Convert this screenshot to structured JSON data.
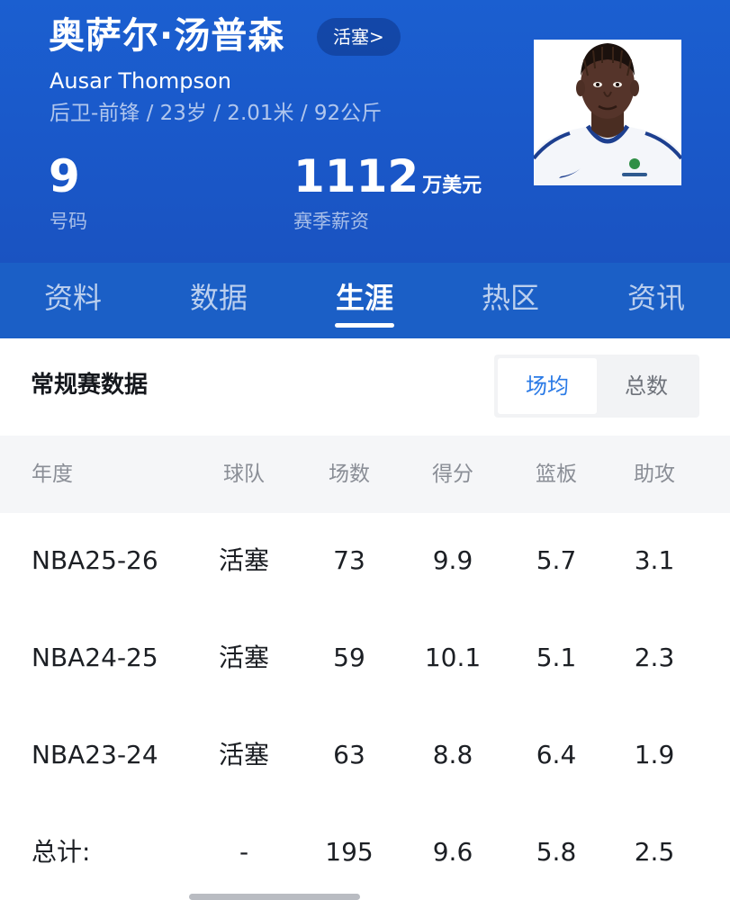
{
  "player": {
    "name_cn": "奥萨尔·汤普森",
    "name_en": "Ausar Thompson",
    "bio": "后卫-前锋 / 23岁 / 2.01米 / 92公斤",
    "team_link": "活塞>",
    "number_value": "9",
    "number_label": "号码",
    "salary_value": "1112",
    "salary_unit": "万美元",
    "salary_label": "赛季薪资"
  },
  "tabs": [
    {
      "label": "资料",
      "active": false
    },
    {
      "label": "数据",
      "active": false
    },
    {
      "label": "生涯",
      "active": true
    },
    {
      "label": "热区",
      "active": false
    },
    {
      "label": "资讯",
      "active": false
    }
  ],
  "section": {
    "title": "常规赛数据",
    "toggle_active": "场均",
    "toggle_inactive": "总数"
  },
  "table": {
    "headers": [
      "年度",
      "球队",
      "场数",
      "得分",
      "篮板",
      "助攻"
    ],
    "rows": [
      [
        "NBA25-26",
        "活塞",
        "73",
        "9.9",
        "5.7",
        "3.1"
      ],
      [
        "NBA24-25",
        "活塞",
        "59",
        "10.1",
        "5.1",
        "2.3"
      ],
      [
        "NBA23-24",
        "活塞",
        "63",
        "8.8",
        "6.4",
        "1.9"
      ],
      [
        "总计:",
        "-",
        "195",
        "9.6",
        "5.8",
        "2.5"
      ]
    ]
  },
  "colors": {
    "header_blue": "#1b5fd0",
    "tab_bar_blue": "#1b5fc6",
    "accent_blue": "#2a7ae6"
  },
  "icons": {
    "avatar": "player-photo"
  }
}
